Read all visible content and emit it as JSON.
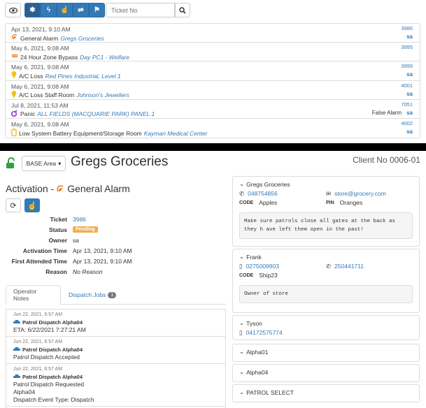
{
  "toolbar": {
    "ticket_placeholder": "Ticket No"
  },
  "alarms": [
    {
      "date": "Apr 13, 2021, 9:10 AM",
      "type": "General Alarm",
      "site": "Gregs Groceries",
      "num": "3986",
      "user": "sa",
      "icon": "alarm-wave-icon",
      "color": "#e8761e"
    },
    {
      "date": "May 6, 2021, 9:08 AM",
      "type": "24 Hour Zone Bypass",
      "site": "Day PC1 - Welfare",
      "num": "3995",
      "user": "",
      "icon": "bypass-icon",
      "color": "#e8761e"
    },
    {
      "date": "May 6, 2021, 9:08 AM",
      "type": "A/C Loss",
      "site": "Red Pines Industrial, Level 1",
      "num": "3999",
      "user": "sa",
      "icon": "lightbulb-icon",
      "color": "#f0c419"
    },
    {
      "date": "May 6, 2021, 9:08 AM",
      "type": "A/C Loss Staff Room",
      "site": "Johnson's Jewellers",
      "num": "4001",
      "user": "sa",
      "icon": "lightbulb-icon",
      "color": "#f0c419"
    },
    {
      "date": "Jul 8, 2021, 11:53 AM",
      "type": "Panic",
      "site": "ALL FIELDS (MACQUARIE PARK) PANEL 1",
      "num": "7051",
      "user": "sa",
      "status": "False Alarm",
      "icon": "panic-icon",
      "color": "#9b30d9"
    },
    {
      "date": "May 6, 2021, 9:08 AM",
      "type": "Low System Battery Equipment/Storage Room",
      "site": "Kayman Medical Center",
      "num": "4002",
      "user": "sa",
      "icon": "battery-icon",
      "color": "#f0c419"
    }
  ],
  "client": {
    "area": "BASE Area",
    "name": "Gregs Groceries",
    "client_no": "Client No 0006-01"
  },
  "activation": {
    "title": "Activation -",
    "type": "General Alarm",
    "fields": [
      {
        "k": "Ticket",
        "v": "3986"
      },
      {
        "k": "Status",
        "v": "Pending"
      },
      {
        "k": "Owner",
        "v": "sa"
      },
      {
        "k": "Activation Time",
        "v": "Apr 13, 2021, 9:10 AM"
      },
      {
        "k": "First Attended Time",
        "v": "Apr 13, 2021, 9:10 AM"
      },
      {
        "k": "Reason",
        "v": "No Reason"
      }
    ]
  },
  "tabs": {
    "notes": "Operator Notes",
    "jobs": "Dispatch Jobs",
    "jobs_count": "1"
  },
  "notes": [
    {
      "date": "Jun 22, 2021, 6:57 AM",
      "head": "Patrol Dispatch Alpha04",
      "lines": [
        "ETA: 6/22/2021 7:27:21 AM"
      ]
    },
    {
      "date": "Jun 22, 2021, 6:57 AM",
      "head": "Patrol Dispatch Alpha04",
      "lines": [
        "Patrol Dispatch Accepted"
      ]
    },
    {
      "date": "Jun 22, 2021, 6:57 AM",
      "head": "Patrol Dispatch Alpha04",
      "lines": [
        "Patrol Dispatch Requested",
        "Alpha04",
        "Dispatch Event Type: Dispatch"
      ]
    }
  ],
  "contacts": {
    "site": {
      "name": "Gregs Groceries",
      "phone": "048754856",
      "email": "store@grocery.com",
      "code_label": "CODE",
      "code": "Apples",
      "pin_label": "PIN",
      "pin": "Oranges",
      "note": "Make sure patrols close all gates at the back as they h ave left them open in the past!"
    },
    "frank": {
      "name": "Frank",
      "mobile": "0275009903",
      "phone": "250441711",
      "code_label": "CODE",
      "code": "Ship23",
      "note": "Owner of store"
    },
    "tyson": {
      "name": "Tyson",
      "mobile": "04172575774"
    },
    "collapsed": [
      "Alpha01",
      "Alpha04",
      "PATROL SELECT"
    ]
  }
}
